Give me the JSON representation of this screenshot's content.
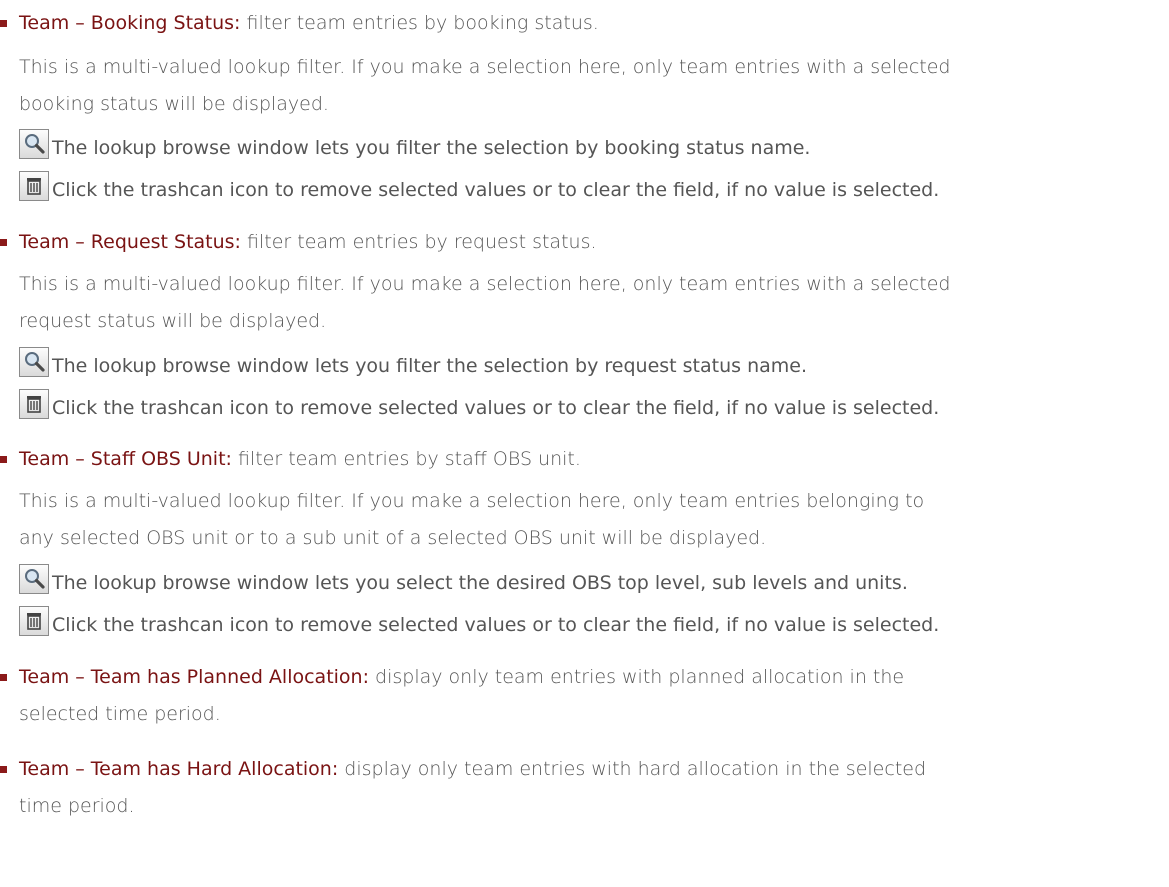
{
  "colors": {
    "bullet": "#8b1a1a",
    "term": "#7a1313",
    "text": "#555555"
  },
  "items": [
    {
      "term": "Team – Booking Status:",
      "desc": " filter team entries by booking status.",
      "para": [
        "This is a multi-valued lookup filter. If you make a selection here, only team entries with a selected",
        "booking status will be displayed."
      ],
      "lookup_icon": "search-icon",
      "lookup_text": "The lookup browse window lets you filter the selection by booking status name.",
      "trash_icon": "trashcan-icon",
      "trash_text": "Click the trashcan icon to remove selected values or to clear the field, if no value is selected."
    },
    {
      "term": "Team – Request Status:",
      "desc": " filter team entries by request status.",
      "para": [
        "This is a multi-valued lookup filter. If you make a selection here, only team entries with a selected",
        "request status will be displayed."
      ],
      "lookup_icon": "search-icon",
      "lookup_text": "The lookup browse window lets you filter the selection by request status name.",
      "trash_icon": "trashcan-icon",
      "trash_text": "Click the trashcan icon to remove selected values or to clear the field, if no value is selected."
    },
    {
      "term": "Team – Staff OBS Unit:",
      "desc": " filter team entries by staff OBS unit.",
      "para": [
        "This is a multi-valued lookup filter. If you make a selection here, only team entries belonging to",
        "any selected OBS unit or to a sub unit of a selected OBS unit will be displayed."
      ],
      "lookup_icon": "search-icon",
      "lookup_text": "The lookup browse window lets you select the desired OBS top level, sub levels and units.",
      "trash_icon": "trashcan-icon",
      "trash_text": "Click the trashcan icon to remove selected values or to clear the field, if no value is selected."
    },
    {
      "term": "Team – Team has Planned Allocation:",
      "desc": " display only team entries with planned allocation in the",
      "cont": "selected time period."
    },
    {
      "term": "Team – Team has Hard Allocation:",
      "desc": " display only team entries with hard allocation in the selected",
      "cont": "time period."
    }
  ]
}
